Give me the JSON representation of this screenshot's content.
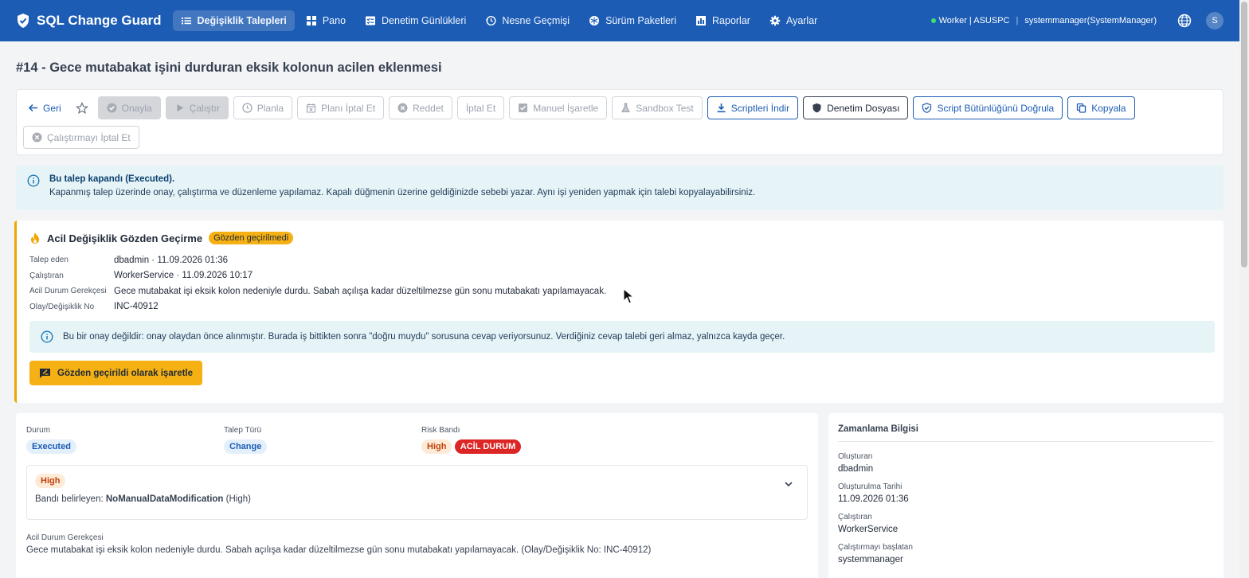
{
  "app": {
    "title": "SQL Change Guard"
  },
  "nav": {
    "items": [
      {
        "label": "Değişiklik Talepleri",
        "icon": "list-icon",
        "active": true
      },
      {
        "label": "Pano",
        "icon": "grid-icon"
      },
      {
        "label": "Denetim Günlükleri",
        "icon": "checklist-icon"
      },
      {
        "label": "Nesne Geçmişi",
        "icon": "history-icon"
      },
      {
        "label": "Sürüm Paketleri",
        "icon": "package-icon"
      },
      {
        "label": "Raporlar",
        "icon": "chart-icon"
      },
      {
        "label": "Ayarlar",
        "icon": "gear-icon"
      }
    ],
    "status": "Worker | ASUSPC",
    "sep": "|",
    "user": "systemmanager(SystemManager)",
    "avatar": "S"
  },
  "page": {
    "title": "#14 - Gece mutabakat işini durduran eksik kolonun acilen eklenmesi"
  },
  "toolbar": {
    "back": "Geri",
    "approve": "Onayla",
    "run": "Çalıştır",
    "plan": "Planla",
    "cancel_plan": "Planı İptal Et",
    "reject": "Reddet",
    "cancel": "İptal Et",
    "manual": "Manuel İşaretle",
    "sandbox": "Sandbox Test",
    "download": "Scriptleri İndir",
    "audit": "Denetim Dosyası",
    "verify": "Script Bütünlüğünü Doğrula",
    "copy": "Kopyala",
    "cancel_run": "Çalıştırmayı İptal Et"
  },
  "banner": {
    "title": "Bu talep kapandı (Executed).",
    "text": "Kapanmış talep üzerinde onay, çalıştırma ve düzenleme yapılamaz. Kapalı düğmenin üzerine geldiğinizde sebebi yazar. Aynı işi yeniden yapmak için talebi kopyalayabilirsiniz."
  },
  "emergency": {
    "title": "Acil Değişiklik Gözden Geçirme",
    "badge": "Gözden geçirilmedi",
    "rows": [
      {
        "k": "Talep eden",
        "v": "dbadmin · 11.09.2026 01:36"
      },
      {
        "k": "Çalıştıran",
        "v": "WorkerService · 11.09.2026 10:17"
      },
      {
        "k": "Acil Durum Gerekçesi",
        "v": "Gece mutabakat işi eksik kolon nedeniyle durdu. Sabah açılışa kadar düzeltilmezse gün sonu mutabakatı yapılamayacak."
      },
      {
        "k": "Olay/Değişiklik No",
        "v": "INC-40912"
      }
    ],
    "note": "Bu bir onay değildir: onay olaydan önce alınmıştır. Burada iş bittikten sonra \"doğru muydu\" sorusuna cevap veriyorsunuz. Verdiğiniz cevap talebi geri almaz, yalnızca kayda geçer.",
    "button": "Gözden geçirildi olarak işaretle"
  },
  "details": {
    "status_label": "Durum",
    "status": "Executed",
    "type_label": "Talep Türü",
    "type": "Change",
    "risk_label": "Risk Bandı",
    "risk": "High",
    "emergency": "ACİL DURUM",
    "risk_box": {
      "band": "High",
      "prefix": "Bandı belirleyen: ",
      "rule": "NoManualDataModification",
      "suffix": " (High)"
    },
    "reason_label": "Acil Durum Gerekçesi",
    "reason": "Gece mutabakat işi eksik kolon nedeniyle durdu. Sabah açılışa kadar düzeltilmezse gün sonu mutabakatı yapılamayacak. (Olay/Değişiklik No: INC-40912)"
  },
  "timing": {
    "title": "Zamanlama Bilgisi",
    "items": [
      {
        "l": "Oluşturan",
        "v": "dbadmin"
      },
      {
        "l": "Oluşturulma Tarihi",
        "v": "11.09.2026 01:36"
      },
      {
        "l": "Çalıştıran",
        "v": "WorkerService"
      },
      {
        "l": "Çalıştırmayı başlatan",
        "v": "systemmanager"
      }
    ]
  }
}
